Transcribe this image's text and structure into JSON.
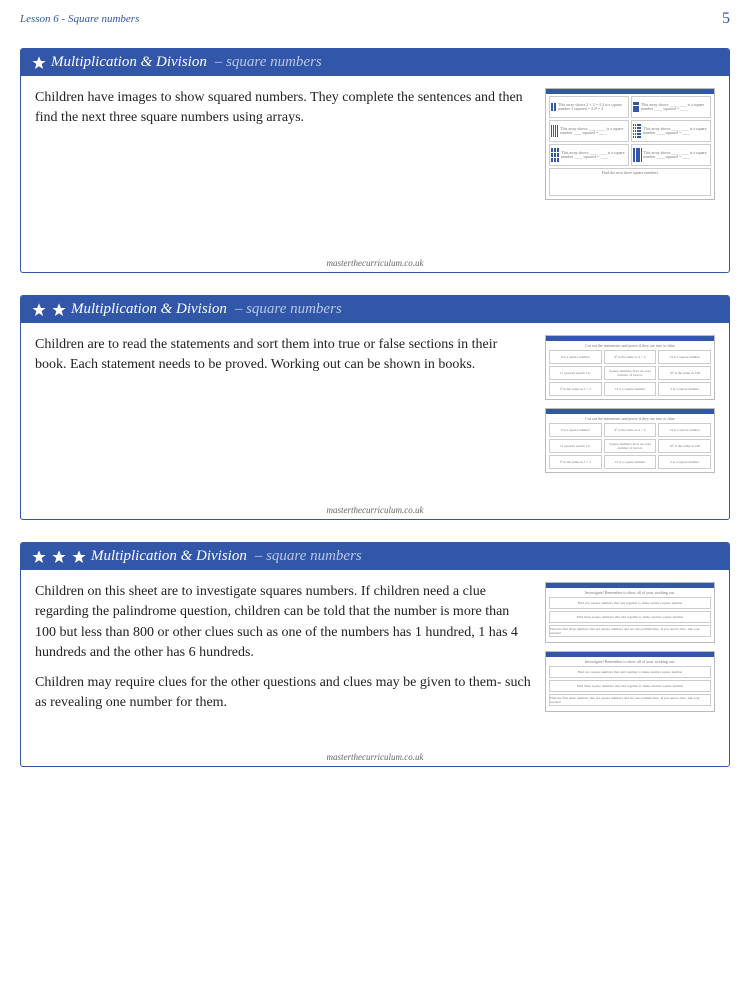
{
  "header": {
    "lesson": "Lesson 6 - Square numbers",
    "page": "5"
  },
  "footer_url": "masterthecurriculum.co.uk",
  "cards": [
    {
      "stars": 1,
      "title_prefix": "Multiplication & Division",
      "title_suffix": "– square numbers",
      "paragraphs": [
        "Children have images to show squared numbers. They complete the sentences and then find the next three square numbers using arrays."
      ]
    },
    {
      "stars": 2,
      "title_prefix": "Multiplication & Division",
      "title_suffix": "– square numbers",
      "paragraphs": [
        "Children are to read the statements and sort them into true or false sections in their book. Each statement needs to be proved. Working out can be shown in books."
      ]
    },
    {
      "stars": 3,
      "title_prefix": "Multiplication & Division",
      "title_suffix": "– square numbers",
      "paragraphs": [
        "Children on this sheet are to investigate squares numbers. If children need a clue regarding the palindrome question, children can be told that the number is more than 100 but less than 800 or other clues such as one of the numbers has 1 hundred, 1 has 4 hundreds and the other has 6 hundreds.",
        "Children may require clues for the other questions and clues may be given to them- such as revealing one number for them."
      ]
    }
  ],
  "thumb_text": {
    "arrays_header": "This array shows 2 × 2 = 4\n4 is a square number\n2 squared = 4\n2² = 4",
    "array_blank": "This array shows ____\n____ is a square number\n____ squared = ____",
    "find_next": "Find the next three square numbers",
    "sort_header": "Cut out the statements and prove if they are true or false",
    "stmts": [
      "9 is a square number",
      "4² is the same as 4 × 4",
      "14 is a square number",
      "11 squared equals 111",
      "Square numbers have an even number of factors",
      "10² is the same as 100",
      "5² is the same as 5 × 2",
      "13 is a square number",
      "3 is a square number"
    ],
    "inv_header": "Investigate! Remember to show all of your working out.",
    "inv1": "Find two square numbers that add together to make another square number",
    "inv2": "Find three square numbers that add together to make another square number",
    "inv3": "Find the first three numbers that are square numbers and are also palindromes. If you need a clue- ask your teacher!"
  }
}
